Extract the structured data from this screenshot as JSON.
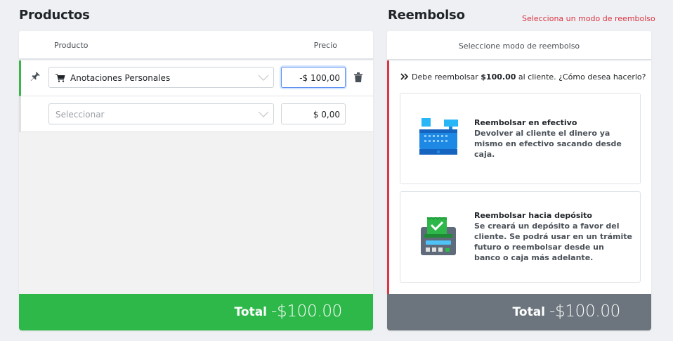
{
  "products_section": {
    "title": "Productos",
    "headers": {
      "product": "Producto",
      "price": "Precio"
    },
    "rows": [
      {
        "product": "Anotaciones Personales",
        "price": "-$ 100,00"
      },
      {
        "placeholder": "Seleccionar",
        "price": "$ 0,00"
      }
    ],
    "total_label": "Total",
    "total_value": "-$100.00"
  },
  "refund_section": {
    "title": "Reembolso",
    "warning": "Selecciona un modo de reembolso",
    "header": "Seleccione modo de reembolso",
    "question_pre": "Debe reembolsar ",
    "question_amount": "$100.00",
    "question_post": " al cliente. ¿Cómo desea hacerlo?",
    "options": [
      {
        "title": "Reembolsar en efectivo",
        "description": "Devolver al cliente el dinero ya mismo en efectivo sacando desde caja.",
        "icon": "cash-register-icon"
      },
      {
        "title": "Reembolsar hacia depósito",
        "description": "Se creará un depósito a favor del cliente. Se podrá usar en un trámite futuro o reembolsar desde un banco o caja más adelante.",
        "icon": "deposit-machine-icon"
      }
    ],
    "total_label": "Total",
    "total_value": "-$100.00"
  },
  "colors": {
    "success": "#2eb84a",
    "danger": "#dc3545",
    "neutral": "#6c757d",
    "accent": "#0d6efd"
  }
}
